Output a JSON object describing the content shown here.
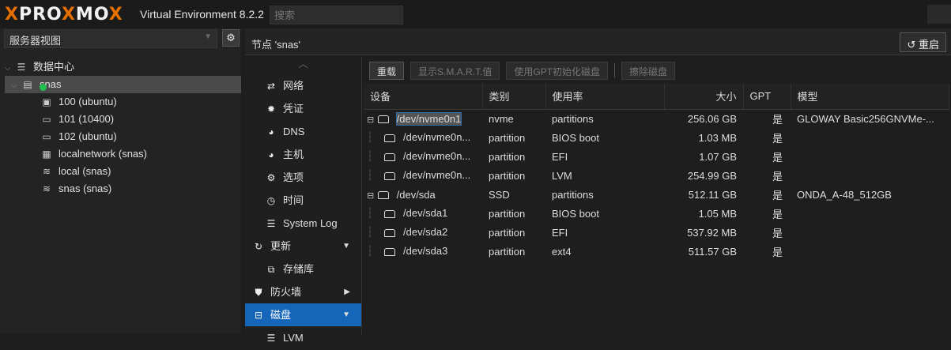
{
  "header": {
    "logo": "PROXMOX",
    "version": "Virtual Environment 8.2.2",
    "search_placeholder": "搜索"
  },
  "left": {
    "view": "服务器视图",
    "tree": [
      {
        "label": "数据中心",
        "icon": "datacenter-icon",
        "level": 0
      },
      {
        "label": "snas",
        "icon": "node-online-icon",
        "level": 1,
        "selected": true
      },
      {
        "label": "100 (ubuntu)",
        "icon": "container-icon",
        "level": 2
      },
      {
        "label": "101 (10400)",
        "icon": "vm-icon",
        "level": 2
      },
      {
        "label": "102 (ubuntu)",
        "icon": "vm-icon",
        "level": 2
      },
      {
        "label": "localnetwork (snas)",
        "icon": "network-grid-icon",
        "level": 2
      },
      {
        "label": "local (snas)",
        "icon": "storage-icon",
        "level": 2
      },
      {
        "label": "snas (snas)",
        "icon": "storage-icon",
        "level": 2
      }
    ]
  },
  "main": {
    "title": "节点 'snas'",
    "reboot": "重启"
  },
  "nav": [
    {
      "label": "网络",
      "icon": "network-icon",
      "sub": true
    },
    {
      "label": "凭证",
      "icon": "certificate-icon",
      "sub": true
    },
    {
      "label": "DNS",
      "icon": "globe-icon",
      "sub": true
    },
    {
      "label": "主机",
      "icon": "globe-icon",
      "sub": true
    },
    {
      "label": "选项",
      "icon": "gear-icon",
      "sub": true
    },
    {
      "label": "时间",
      "icon": "clock-icon",
      "sub": true
    },
    {
      "label": "System Log",
      "icon": "list-icon",
      "sub": true
    },
    {
      "label": "更新",
      "icon": "refresh-icon",
      "arrow": "down"
    },
    {
      "label": "存储库",
      "icon": "repository-icon",
      "sub": true
    },
    {
      "label": "防火墙",
      "icon": "shield-icon",
      "arrow": "right"
    },
    {
      "label": "磁盘",
      "icon": "disk-icon",
      "arrow": "down",
      "active": true
    },
    {
      "label": "LVM",
      "icon": "list-icon",
      "sub": true
    }
  ],
  "toolbar": {
    "reload": "重载",
    "smart": "显示S.M.A.R.T.值",
    "gpt_init": "使用GPT初始化磁盘",
    "wipe": "擦除磁盘"
  },
  "columns": [
    "设备",
    "类别",
    "使用率",
    "大小",
    "GPT",
    "模型"
  ],
  "rows": [
    {
      "device": "/dev/nvme0n1",
      "type": "nvme",
      "usage": "partitions",
      "size": "256.06 GB",
      "gpt": "是",
      "model": "GLOWAY Basic256GNVMe-...",
      "level": 0,
      "selected": true
    },
    {
      "device": "/dev/nvme0n...",
      "type": "partition",
      "usage": "BIOS boot",
      "size": "1.03 MB",
      "gpt": "是",
      "model": "",
      "level": 1
    },
    {
      "device": "/dev/nvme0n...",
      "type": "partition",
      "usage": "EFI",
      "size": "1.07 GB",
      "gpt": "是",
      "model": "",
      "level": 1
    },
    {
      "device": "/dev/nvme0n...",
      "type": "partition",
      "usage": "LVM",
      "size": "254.99 GB",
      "gpt": "是",
      "model": "",
      "level": 1
    },
    {
      "device": "/dev/sda",
      "type": "SSD",
      "usage": "partitions",
      "size": "512.11 GB",
      "gpt": "是",
      "model": "ONDA_A-48_512GB",
      "level": 0
    },
    {
      "device": "/dev/sda1",
      "type": "partition",
      "usage": "BIOS boot",
      "size": "1.05 MB",
      "gpt": "是",
      "model": "",
      "level": 1
    },
    {
      "device": "/dev/sda2",
      "type": "partition",
      "usage": "EFI",
      "size": "537.92 MB",
      "gpt": "是",
      "model": "",
      "level": 1
    },
    {
      "device": "/dev/sda3",
      "type": "partition",
      "usage": "ext4",
      "size": "511.57 GB",
      "gpt": "是",
      "model": "",
      "level": 1
    }
  ],
  "colors": {
    "accent": "#e57000",
    "active": "#1565b8",
    "status_ok": "#21bf4b"
  }
}
